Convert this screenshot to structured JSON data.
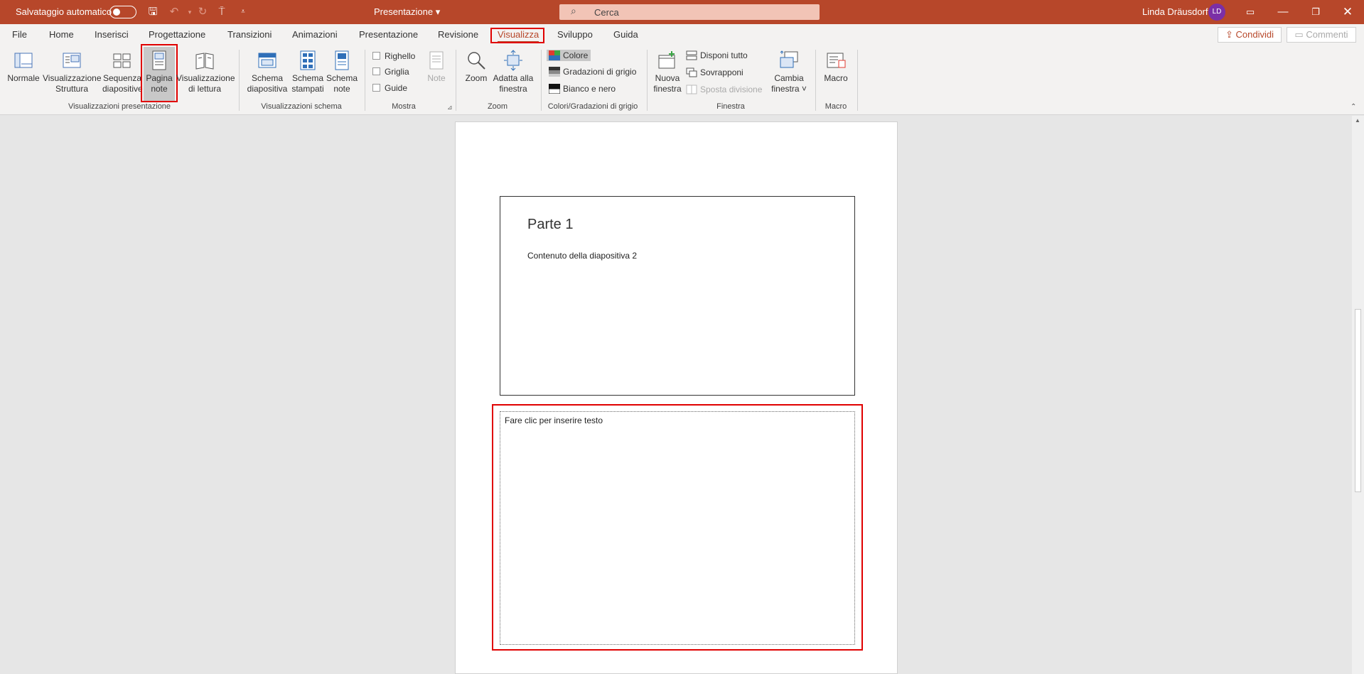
{
  "titlebar": {
    "autosave_label": "Salvataggio automatico",
    "doc_title": "Presentazione",
    "search_placeholder": "Cerca",
    "user_name": "Linda Dräusdorf",
    "user_initials": "LD"
  },
  "tabs": [
    "File",
    "Home",
    "Inserisci",
    "Progettazione",
    "Transizioni",
    "Animazioni",
    "Presentazione",
    "Revisione",
    "Visualizza",
    "Sviluppo",
    "Guida"
  ],
  "active_tab": "Visualizza",
  "actions": {
    "share": "Condividi",
    "comments": "Commenti"
  },
  "ribbon": {
    "presentation_views": {
      "normal": "Normale",
      "outline_1": "Visualizzazione",
      "outline_2": "Struttura",
      "sorter_1": "Sequenza",
      "sorter_2": "diapositive",
      "notes_1": "Pagina",
      "notes_2": "note",
      "reading_1": "Visualizzazione",
      "reading_2": "di lettura",
      "group": "Visualizzazioni presentazione"
    },
    "master_views": {
      "slide_1": "Schema",
      "slide_2": "diapositiva",
      "handout_1": "Schema",
      "handout_2": "stampati",
      "notes_1": "Schema",
      "notes_2": "note",
      "group": "Visualizzazioni schema"
    },
    "show": {
      "ruler": "Righello",
      "grid": "Griglia",
      "guides": "Guide",
      "notes": "Note",
      "group": "Mostra"
    },
    "zoom": {
      "zoom": "Zoom",
      "fit_1": "Adatta alla",
      "fit_2": "finestra",
      "group": "Zoom"
    },
    "color": {
      "color": "Colore",
      "grayscale": "Gradazioni di grigio",
      "bw": "Bianco e nero",
      "group": "Colori/Gradazioni di grigio"
    },
    "window": {
      "new_1": "Nuova",
      "new_2": "finestra",
      "arrange": "Disponi tutto",
      "cascade": "Sovrapponi",
      "split": "Sposta divisione",
      "switch_1": "Cambia",
      "switch_2": "finestra ˅",
      "group": "Finestra"
    },
    "macro": {
      "macro": "Macro",
      "group": "Macro"
    }
  },
  "slide": {
    "title": "Parte 1",
    "content": "Contenuto della diapositiva 2"
  },
  "notes": {
    "placeholder": "Fare clic per inserire testo"
  },
  "colors": {
    "accent": "#b7472a",
    "highlight": "#e00000"
  }
}
